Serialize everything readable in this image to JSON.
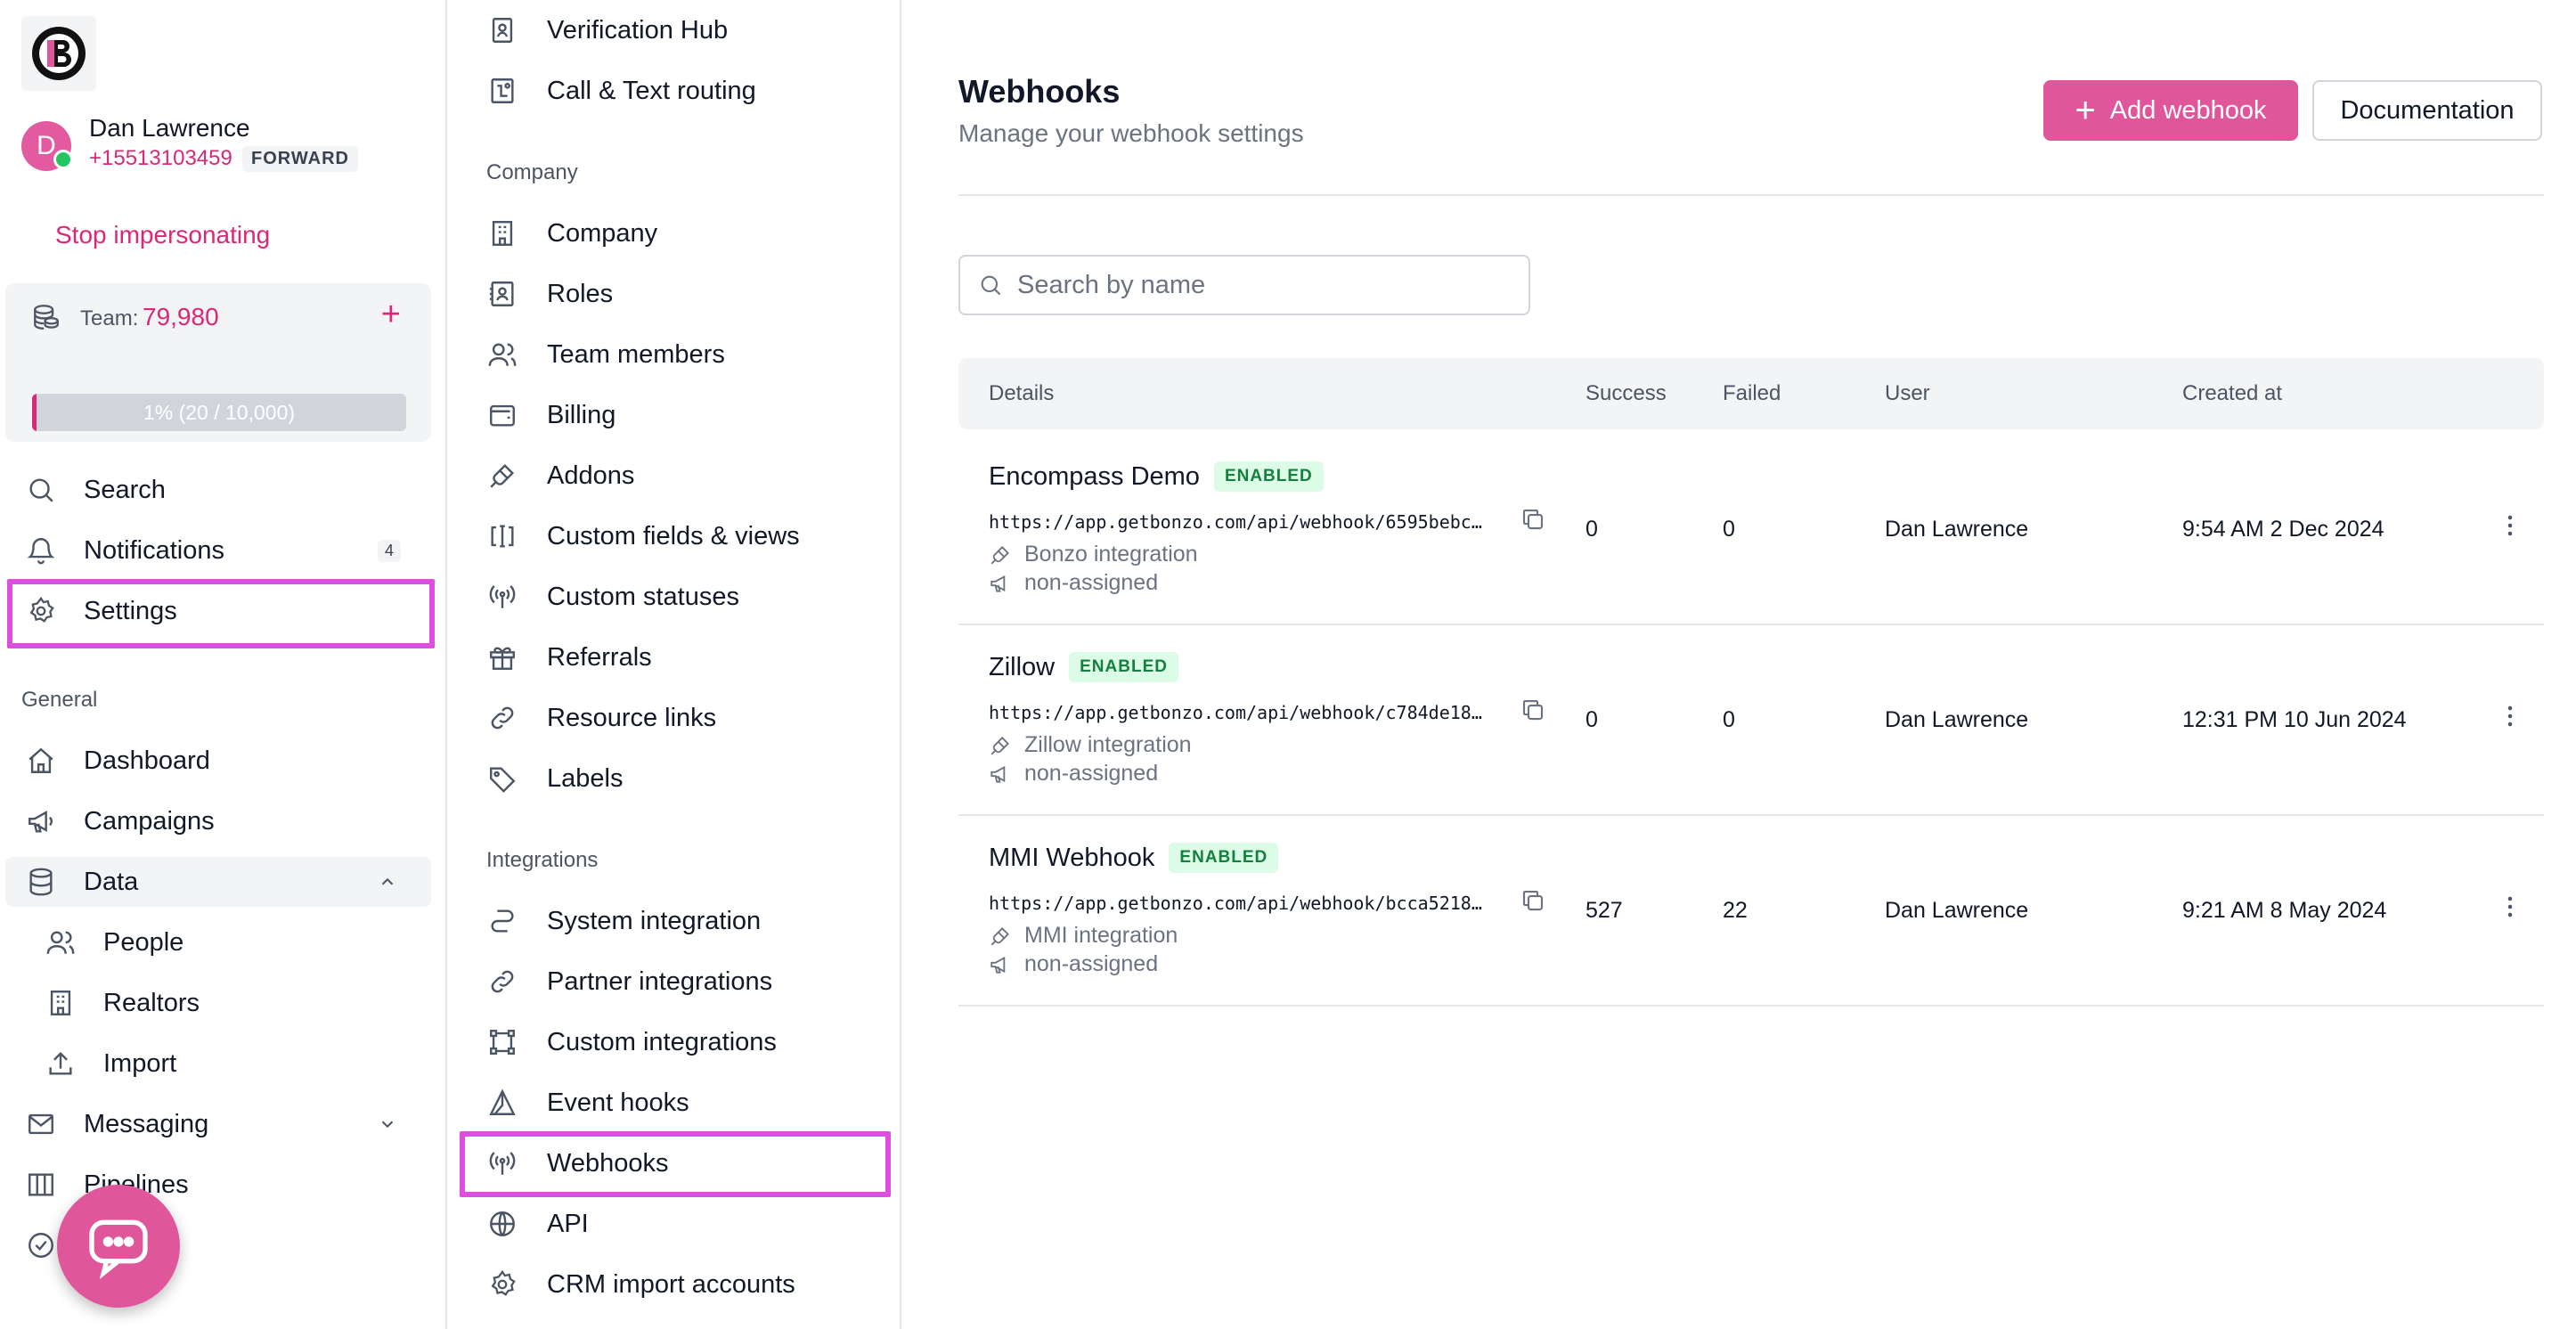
{
  "user": {
    "initial": "D",
    "name": "Dan Lawrence",
    "phone": "+15513103459",
    "badge": "FORWARD",
    "stop_label": "Stop impersonating"
  },
  "team": {
    "label": "Team:",
    "value": "79,980",
    "progress_text": "1% (20 / 10,000)",
    "progress_fraction": 0.01
  },
  "nav": {
    "search": "Search",
    "notifications": "Notifications",
    "notifications_count": "4",
    "settings": "Settings",
    "general_label": "General",
    "dashboard": "Dashboard",
    "campaigns": "Campaigns",
    "data": "Data",
    "people": "People",
    "realtors": "Realtors",
    "import": "Import",
    "messaging": "Messaging",
    "pipelines": "Pipelines"
  },
  "settings_nav": {
    "verification_hub": "Verification Hub",
    "call_text_routing": "Call & Text routing",
    "company_label": "Company",
    "company": "Company",
    "roles": "Roles",
    "team_members": "Team members",
    "billing": "Billing",
    "addons": "Addons",
    "custom_fields": "Custom fields & views",
    "custom_statuses": "Custom statuses",
    "referrals": "Referrals",
    "resource_links": "Resource links",
    "labels": "Labels",
    "integrations_label": "Integrations",
    "system_integration": "System integration",
    "partner_integrations": "Partner integrations",
    "custom_integrations": "Custom integrations",
    "event_hooks": "Event hooks",
    "webhooks": "Webhooks",
    "api": "API",
    "crm_import": "CRM import accounts"
  },
  "page": {
    "title": "Webhooks",
    "subtitle": "Manage your webhook settings",
    "add_button": "Add webhook",
    "docs_button": "Documentation",
    "search_placeholder": "Search by name"
  },
  "table": {
    "columns": {
      "details": "Details",
      "success": "Success",
      "failed": "Failed",
      "user": "User",
      "created": "Created at"
    },
    "rows": [
      {
        "name": "Encompass Demo",
        "status": "ENABLED",
        "url": "https://app.getbonzo.com/api/webhook/6595bebc…",
        "integration": "Bonzo integration",
        "assignment": "non-assigned",
        "success": "0",
        "failed": "0",
        "user": "Dan Lawrence",
        "created": "9:54 AM 2 Dec 2024"
      },
      {
        "name": "Zillow",
        "status": "ENABLED",
        "url": "https://app.getbonzo.com/api/webhook/c784de18…",
        "integration": "Zillow integration",
        "assignment": "non-assigned",
        "success": "0",
        "failed": "0",
        "user": "Dan Lawrence",
        "created": "12:31 PM 10 Jun 2024"
      },
      {
        "name": "MMI Webhook",
        "status": "ENABLED",
        "url": "https://app.getbonzo.com/api/webhook/bcca5218…",
        "integration": "MMI integration",
        "assignment": "non-assigned",
        "success": "527",
        "failed": "22",
        "user": "Dan Lawrence",
        "created": "9:21 AM 8 May 2024"
      }
    ]
  },
  "colors": {
    "accent": "#e0569b",
    "highlight": "#e04ee0",
    "enabled_bg": "#dcfce7",
    "enabled_text": "#15803d"
  }
}
